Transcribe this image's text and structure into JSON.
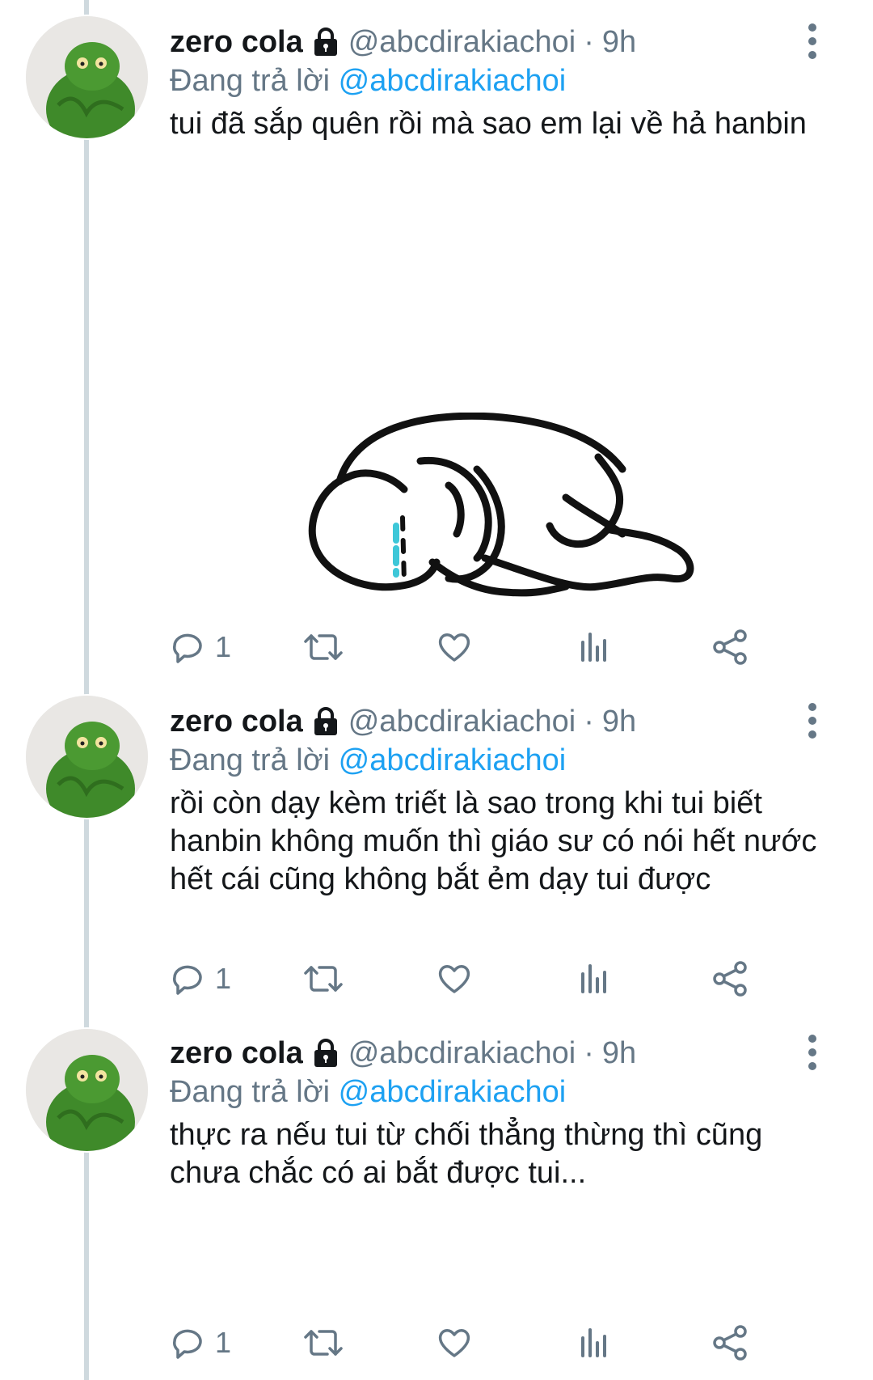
{
  "tweets": [
    {
      "display_name": "zero cola",
      "handle": "@abcdirakiachoi",
      "separator": "·",
      "time": "9h",
      "replying_prefix": "Đang trả lời",
      "replying_to": "@abcdirakiachoi",
      "text": "tui đã sắp quên rồi mà sao em lại về hả hanbin",
      "reply_count": "1",
      "media_icon": "crying-curled-figure-drawing"
    },
    {
      "display_name": "zero cola",
      "handle": "@abcdirakiachoi",
      "separator": "·",
      "time": "9h",
      "replying_prefix": "Đang trả lời",
      "replying_to": "@abcdirakiachoi",
      "text": "rồi còn dạy kèm triết là sao trong khi tui biết hanbin không muốn thì giáo sư có nói hết nước hết cái cũng không bắt ẻm dạy tui được",
      "reply_count": "1"
    },
    {
      "display_name": "zero cola",
      "handle": "@abcdirakiachoi",
      "separator": "·",
      "time": "9h",
      "replying_prefix": "Đang trả lời",
      "replying_to": "@abcdirakiachoi",
      "text": "thực ra nếu tui từ chối thẳng thừng thì cũng chưa chắc có ai bắt được tui...",
      "reply_count": "1"
    }
  ],
  "icons": {
    "lock": "lock-icon",
    "more": "more-vertical-icon",
    "reply": "reply-icon",
    "retweet": "retweet-icon",
    "like": "heart-icon",
    "analytics": "analytics-icon",
    "share": "share-icon"
  },
  "colors": {
    "text": "#14171a",
    "secondary": "#657786",
    "link": "#1da1f2",
    "thread_line": "#cfd9de",
    "icon": "#657786"
  }
}
